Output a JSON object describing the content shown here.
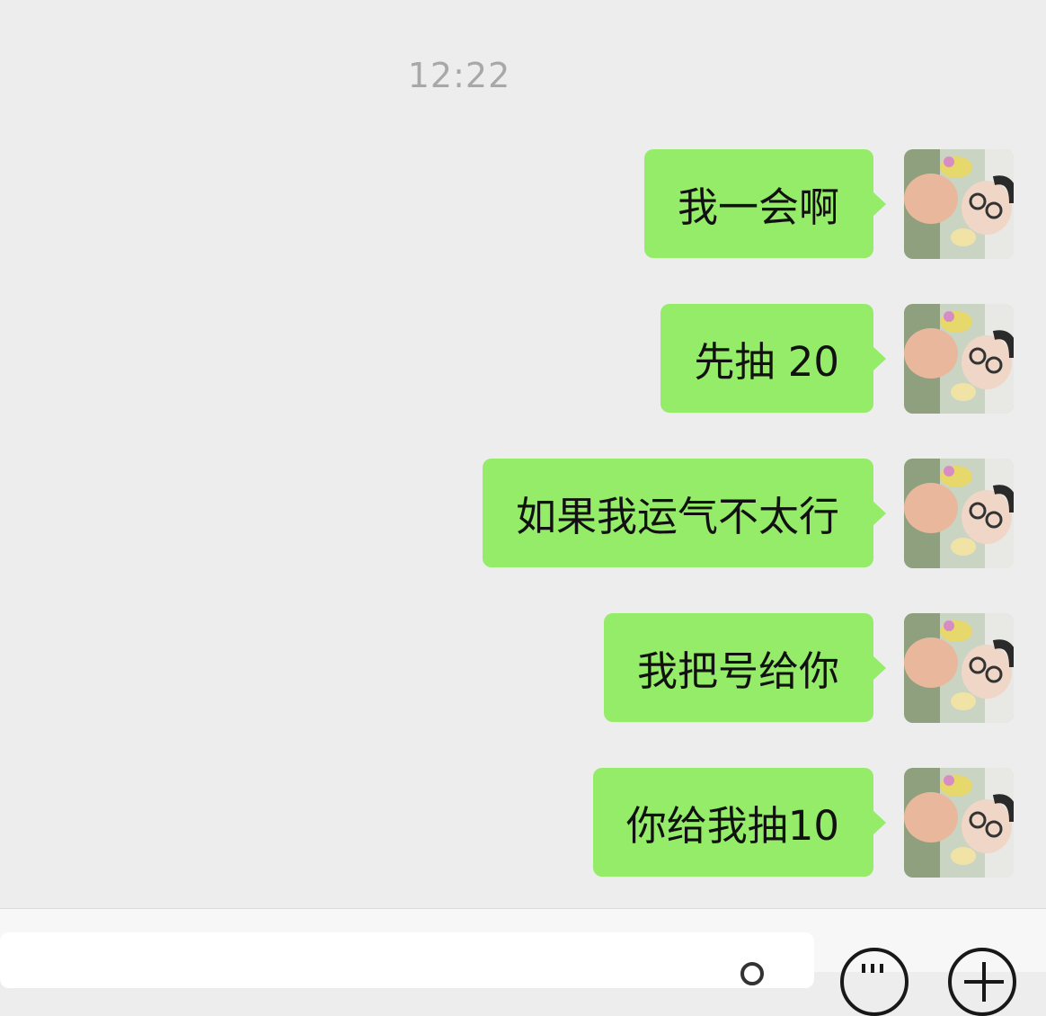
{
  "chat": {
    "timestamp": "12:22",
    "messages": [
      {
        "text": "我一会啊",
        "sender": "self"
      },
      {
        "text": "先抽 20",
        "sender": "self"
      },
      {
        "text": "如果我运气不太行",
        "sender": "self"
      },
      {
        "text": "我把号给你",
        "sender": "self"
      },
      {
        "text": "你给我抽10",
        "sender": "self"
      }
    ]
  },
  "input_bar": {
    "value": "",
    "icons": [
      "voice-icon",
      "emoji-icon",
      "plus-icon"
    ]
  },
  "colors": {
    "background": "#ededed",
    "bubble_self": "#95ec69",
    "timestamp": "#a8a8a8"
  }
}
